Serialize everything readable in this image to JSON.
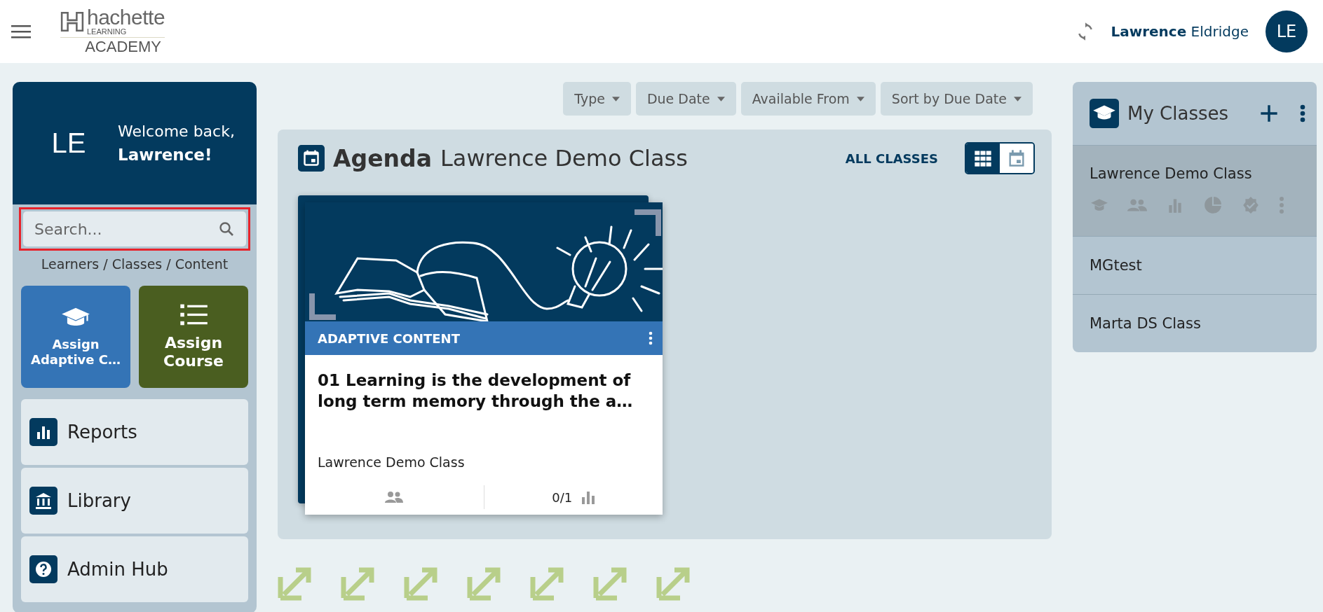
{
  "header": {
    "logo": {
      "brand": "hachette",
      "sub": "LEARNING",
      "product": "ACADEMY"
    },
    "user": {
      "first_name": "Lawrence",
      "last_name": "Eldridge",
      "initials": "LE"
    }
  },
  "sidebar": {
    "profile": {
      "initials": "LE",
      "greeting": "Welcome back,",
      "name": "Lawrence!"
    },
    "search": {
      "placeholder": "Search...",
      "highlighted": true
    },
    "search_scope": "Learners / Classes / Content",
    "tiles": [
      {
        "kind": "adaptive",
        "label": "Assign Adaptive C…"
      },
      {
        "kind": "course",
        "label": "Assign Course"
      }
    ],
    "nav": [
      {
        "kind": "reports",
        "label": "Reports"
      },
      {
        "kind": "library",
        "label": "Library"
      },
      {
        "kind": "help",
        "label": "Admin Hub"
      }
    ]
  },
  "filters": [
    "Type",
    "Due Date",
    "Available From",
    "Sort by Due Date"
  ],
  "agenda": {
    "title": "Agenda",
    "class_name": "Lawrence Demo Class",
    "all_classes": "ALL CLASSES",
    "views": [
      {
        "kind": "grid",
        "selected": true
      },
      {
        "kind": "calendar",
        "selected": false
      }
    ],
    "cards": [
      {
        "category": "ADAPTIVE CONTENT",
        "title": "01 Learning is the development of long term memory through the a…",
        "class_name": "Lawrence Demo Class",
        "progress": "0/1"
      }
    ]
  },
  "my_classes": {
    "title": "My Classes",
    "classes": [
      {
        "name": "Lawrence Demo Class",
        "selected": true
      },
      {
        "name": "MGtest",
        "selected": false
      },
      {
        "name": "Marta DS Class",
        "selected": false
      }
    ]
  }
}
